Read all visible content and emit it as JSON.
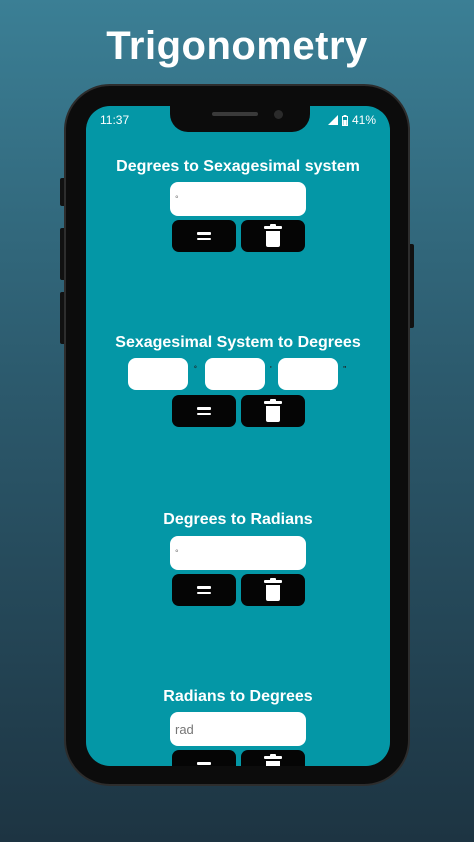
{
  "headline": "Trigonometry",
  "status": {
    "time": "11:37",
    "battery": "41%"
  },
  "sections": [
    {
      "title": "Degrees to Sexagesimal system",
      "placeholder": "°",
      "equals_icon": "equals-icon",
      "clear_icon": "trash-icon"
    },
    {
      "title": "Sexagesimal System to Degrees",
      "units": [
        "°",
        "'",
        "\""
      ],
      "equals_icon": "equals-icon",
      "clear_icon": "trash-icon"
    },
    {
      "title": "Degrees to Radians",
      "placeholder": "°",
      "equals_icon": "equals-icon",
      "clear_icon": "trash-icon"
    },
    {
      "title": "Radians to Degrees",
      "placeholder": "rad",
      "equals_icon": "equals-icon",
      "clear_icon": "trash-icon"
    }
  ],
  "colors": {
    "screen": "#0497a6",
    "button": "#050505",
    "field": "#ffffff"
  }
}
